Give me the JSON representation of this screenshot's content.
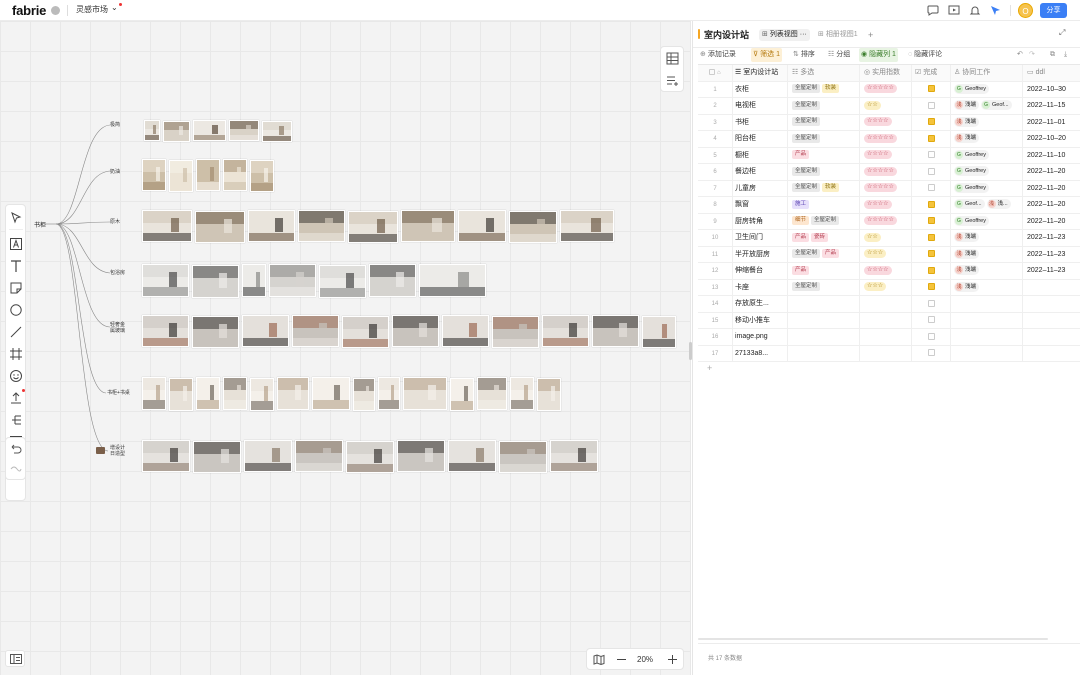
{
  "app": {
    "logo": "fabrie",
    "workspace": "灵感市场",
    "user_initial": "O",
    "share_label": "分享",
    "accent_color": "#3b7ff5"
  },
  "canvas": {
    "zoom": "20%",
    "root_label": "书柜",
    "branches": [
      {
        "label": "极简",
        "thumbs": 5
      },
      {
        "label": "奶油",
        "thumbs": 5
      },
      {
        "label": "原木",
        "thumbs": 10
      },
      {
        "label": "包浴房",
        "thumbs": 8
      },
      {
        "label": "轻奢金\n属玻璃",
        "thumbs": 11
      },
      {
        "label": "书柜+书桌",
        "thumbs": 14
      },
      {
        "label": "增设计\n日造型",
        "thumbs": 10
      }
    ]
  },
  "panel": {
    "title": "室内设计站",
    "tabs": [
      "列表视图 ···",
      "相册视图1"
    ],
    "add_tab": "+",
    "actions": {
      "add_record": "添加记录",
      "filter": "筛选 1",
      "sort": "排序",
      "group": "分组",
      "hidden_cols": "隐藏列 1",
      "hide_comments": "隐藏评论"
    },
    "columns": [
      "室内设计站",
      "多选",
      "实用指数",
      "完成",
      "协同工作",
      "ddl"
    ],
    "rows": [
      {
        "no": "1",
        "name": "衣柜",
        "tags": [
          {
            "t": "全屋定制",
            "c": "grey"
          },
          {
            "t": "软装",
            "c": "yellow"
          }
        ],
        "stars": "☆☆☆☆☆",
        "sc": "pink",
        "done": true,
        "people": [
          {
            "n": "Geoffrey",
            "i": "G",
            "c": "green"
          }
        ],
        "ddl": "2022–10–30"
      },
      {
        "no": "2",
        "name": "电视柜",
        "tags": [
          {
            "t": "全屋定制",
            "c": "grey"
          }
        ],
        "stars": "☆☆",
        "sc": "yellow",
        "done": false,
        "people": [
          {
            "n": "浅端",
            "i": "浅",
            "c": "red"
          },
          {
            "n": "Geof...",
            "i": "G",
            "c": "green"
          }
        ],
        "ddl": "2022–11–15"
      },
      {
        "no": "3",
        "name": "书柜",
        "tags": [
          {
            "t": "全屋定制",
            "c": "grey"
          }
        ],
        "stars": "☆☆☆☆",
        "sc": "pink",
        "done": true,
        "people": [
          {
            "n": "浅端",
            "i": "浅",
            "c": "red"
          }
        ],
        "ddl": "2022–11–01"
      },
      {
        "no": "4",
        "name": "阳台柜",
        "tags": [
          {
            "t": "全屋定制",
            "c": "grey"
          }
        ],
        "stars": "☆☆☆☆☆",
        "sc": "pink",
        "done": true,
        "people": [
          {
            "n": "浅端",
            "i": "浅",
            "c": "red"
          }
        ],
        "ddl": "2022–10–20"
      },
      {
        "no": "5",
        "name": "橱柜",
        "tags": [
          {
            "t": "产品",
            "c": "pink"
          }
        ],
        "stars": "☆☆☆☆",
        "sc": "pink",
        "done": false,
        "people": [
          {
            "n": "Geoffrey",
            "i": "G",
            "c": "green"
          }
        ],
        "ddl": "2022–11–10"
      },
      {
        "no": "6",
        "name": "餐边柜",
        "tags": [
          {
            "t": "全屋定制",
            "c": "grey"
          }
        ],
        "stars": "☆☆☆☆☆",
        "sc": "pink",
        "done": false,
        "people": [
          {
            "n": "Geoffrey",
            "i": "G",
            "c": "green"
          }
        ],
        "ddl": "2022–11–20"
      },
      {
        "no": "7",
        "name": "儿童房",
        "tags": [
          {
            "t": "全屋定制",
            "c": "grey"
          },
          {
            "t": "软装",
            "c": "yellow"
          }
        ],
        "stars": "☆☆☆☆☆",
        "sc": "pink",
        "done": false,
        "people": [
          {
            "n": "Geoffrey",
            "i": "G",
            "c": "green"
          }
        ],
        "ddl": "2022–11–20"
      },
      {
        "no": "8",
        "name": "飘窗",
        "tags": [
          {
            "t": "施工",
            "c": "purple"
          }
        ],
        "stars": "☆☆☆☆",
        "sc": "pink",
        "done": true,
        "people": [
          {
            "n": "Geof...",
            "i": "G",
            "c": "green"
          },
          {
            "n": "浅...",
            "i": "浅",
            "c": "red"
          }
        ],
        "ddl": "2022–11–20"
      },
      {
        "no": "9",
        "name": "厨房转角",
        "tags": [
          {
            "t": "细节",
            "c": "orange"
          },
          {
            "t": "全屋定制",
            "c": "grey"
          }
        ],
        "stars": "☆☆☆☆☆",
        "sc": "pink",
        "done": true,
        "people": [
          {
            "n": "Geoffrey",
            "i": "G",
            "c": "green"
          }
        ],
        "ddl": "2022–11–20"
      },
      {
        "no": "10",
        "name": "卫生间门",
        "tags": [
          {
            "t": "产品",
            "c": "pink"
          },
          {
            "t": "瓷砖",
            "c": "pink"
          }
        ],
        "stars": "☆☆",
        "sc": "yellow",
        "done": true,
        "people": [
          {
            "n": "浅端",
            "i": "浅",
            "c": "red"
          }
        ],
        "ddl": "2022–11–23"
      },
      {
        "no": "11",
        "name": "半开放厨房",
        "tags": [
          {
            "t": "全屋定制",
            "c": "grey"
          },
          {
            "t": "产品",
            "c": "pink"
          }
        ],
        "stars": "☆☆☆",
        "sc": "yellow",
        "done": true,
        "people": [
          {
            "n": "浅端",
            "i": "浅",
            "c": "red"
          }
        ],
        "ddl": "2022–11–23"
      },
      {
        "no": "12",
        "name": "伸缩餐台",
        "tags": [
          {
            "t": "产品",
            "c": "pink"
          }
        ],
        "stars": "☆☆☆☆",
        "sc": "pink",
        "done": true,
        "people": [
          {
            "n": "浅端",
            "i": "浅",
            "c": "red"
          }
        ],
        "ddl": "2022–11–23"
      },
      {
        "no": "13",
        "name": "卡座",
        "tags": [
          {
            "t": "全屋定制",
            "c": "grey"
          }
        ],
        "stars": "☆☆☆",
        "sc": "yellow",
        "done": true,
        "people": [
          {
            "n": "浅端",
            "i": "浅",
            "c": "red"
          }
        ],
        "ddl": ""
      },
      {
        "no": "14",
        "name": "存放原生...",
        "tags": [],
        "stars": "",
        "sc": "",
        "done": false,
        "people": [],
        "ddl": ""
      },
      {
        "no": "15",
        "name": "移动小推车",
        "tags": [],
        "stars": "",
        "sc": "",
        "done": false,
        "people": [],
        "ddl": ""
      },
      {
        "no": "16",
        "name": "image.png",
        "tags": [],
        "stars": "",
        "sc": "",
        "done": false,
        "people": [],
        "ddl": ""
      },
      {
        "no": "17",
        "name": "27133a8...",
        "tags": [],
        "stars": "",
        "sc": "",
        "done": false,
        "people": [],
        "ddl": ""
      }
    ],
    "add_row": "+",
    "footer": "共 17 条数据"
  },
  "colors": {
    "tag": {
      "grey": [
        "#e9e9e9",
        "#555"
      ],
      "yellow": [
        "#fbefc4",
        "#8a6d0b"
      ],
      "pink": [
        "#fbdde2",
        "#b23a4d"
      ],
      "purple": [
        "#e7e0fb",
        "#5b43b3"
      ],
      "orange": [
        "#fde6cf",
        "#a85b12"
      ]
    },
    "stars": {
      "pink": [
        "#f9d8de",
        "#c0465a"
      ],
      "yellow": [
        "#fbefc4",
        "#a57c06"
      ]
    },
    "avatar": {
      "green": [
        "#d8f0d3",
        "#2f7d25"
      ],
      "red": [
        "#f6d3cd",
        "#b0402c"
      ]
    }
  }
}
